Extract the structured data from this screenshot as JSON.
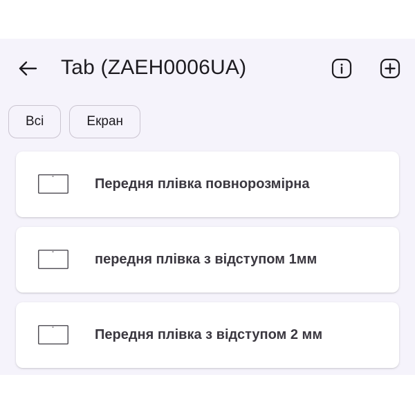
{
  "header": {
    "title": "Tab (ZAEH0006UA)",
    "back_icon": "arrow-left-icon",
    "info_icon": "info-icon",
    "add_icon": "add-box-icon"
  },
  "filters": [
    {
      "label": "Всі"
    },
    {
      "label": "Екран"
    }
  ],
  "items": [
    {
      "label": "Передня плівка повнорозмірна",
      "icon": "screen-outline-icon"
    },
    {
      "label": "передня плівка з відступом 1мм",
      "icon": "screen-outline-icon"
    },
    {
      "label": "Передня плівка з відступом 2 мм",
      "icon": "screen-outline-icon"
    }
  ],
  "colors": {
    "background": "#f5f3fb",
    "card": "#ffffff",
    "text": "#1d1b20",
    "chip_border": "#cac4d0"
  }
}
